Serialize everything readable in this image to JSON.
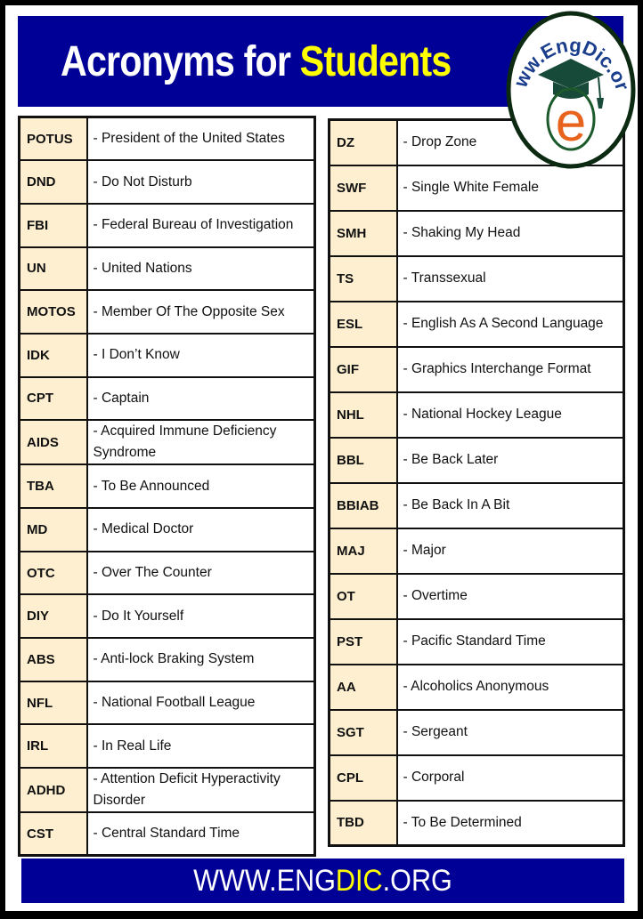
{
  "header": {
    "title_part1": "Acronyms for ",
    "title_part2": "Students",
    "colors": {
      "background": "#000096",
      "title": "#ffffff",
      "highlight": "#ffff00"
    }
  },
  "logo": {
    "text_top": "www.EngDic.org",
    "letter": "e",
    "icon": "graduation-cap-icon"
  },
  "left_table": [
    {
      "abbr": "POTUS",
      "meaning": "- President of the United States"
    },
    {
      "abbr": "DND",
      "meaning": "- Do Not Disturb"
    },
    {
      "abbr": "FBI",
      "meaning": "- Federal Bureau of Investigation"
    },
    {
      "abbr": "UN",
      "meaning": "- United Nations"
    },
    {
      "abbr": "MOTOS",
      "meaning": "- Member Of The Opposite Sex"
    },
    {
      "abbr": "IDK",
      "meaning": "- I Don’t Know"
    },
    {
      "abbr": "CPT",
      "meaning": "- Captain"
    },
    {
      "abbr": "AIDS",
      "meaning": "- Acquired Immune Deficiency Syndrome"
    },
    {
      "abbr": "TBA",
      "meaning": "- To Be Announced"
    },
    {
      "abbr": "MD",
      "meaning": "- Medical Doctor"
    },
    {
      "abbr": "OTC",
      "meaning": "- Over The Counter"
    },
    {
      "abbr": "DIY",
      "meaning": "- Do It Yourself"
    },
    {
      "abbr": "ABS",
      "meaning": "- Anti-lock Braking System"
    },
    {
      "abbr": "NFL",
      "meaning": "- National Football League"
    },
    {
      "abbr": "IRL",
      "meaning": "- In Real Life"
    },
    {
      "abbr": "ADHD",
      "meaning": "- Attention Deficit Hyperactivity Disorder"
    },
    {
      "abbr": "CST",
      "meaning": "- Central Standard Time"
    }
  ],
  "right_table": [
    {
      "abbr": "DZ",
      "meaning": "- Drop Zone"
    },
    {
      "abbr": "SWF",
      "meaning": "- Single White Female"
    },
    {
      "abbr": "SMH",
      "meaning": "- Shaking My Head"
    },
    {
      "abbr": "TS",
      "meaning": "- Transsexual"
    },
    {
      "abbr": "ESL",
      "meaning": "- English As A Second Language"
    },
    {
      "abbr": "GIF",
      "meaning": "- Graphics Interchange Format"
    },
    {
      "abbr": "NHL",
      "meaning": "- National Hockey League"
    },
    {
      "abbr": "BBL",
      "meaning": "- Be Back Later"
    },
    {
      "abbr": "BBIAB",
      "meaning": "- Be Back In A Bit"
    },
    {
      "abbr": "MAJ",
      "meaning": "- Major"
    },
    {
      "abbr": "OT",
      "meaning": "- Overtime"
    },
    {
      "abbr": "PST",
      "meaning": "- Pacific Standard Time"
    },
    {
      "abbr": "AA",
      "meaning": "- Alcoholics Anonymous"
    },
    {
      "abbr": "SGT",
      "meaning": "- Sergeant"
    },
    {
      "abbr": "CPL",
      "meaning": "- Corporal"
    },
    {
      "abbr": "TBD",
      "meaning": "- To Be Determined"
    }
  ],
  "footer": {
    "part1": "WWW.ENG",
    "part2": "DIC",
    "part3": ".ORG"
  },
  "colors": {
    "abbr_cell": "#fdefcf",
    "border": "#111111",
    "frame": "#000000"
  }
}
